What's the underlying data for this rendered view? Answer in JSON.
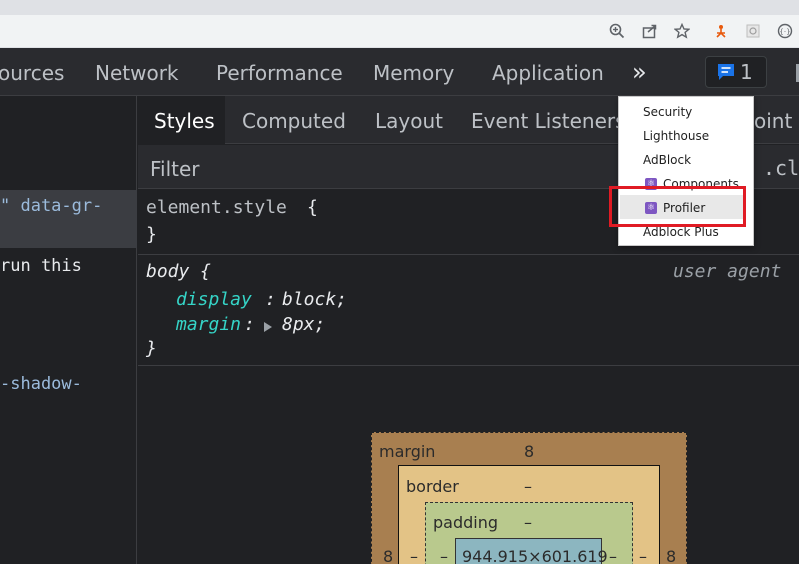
{
  "browser": {
    "icons": [
      "zoom-icon",
      "share-icon",
      "star-icon",
      "extension-ext1-icon",
      "extension-ext2-icon",
      "extension-ext3-icon"
    ]
  },
  "devtools": {
    "panel_tabs": [
      "ources",
      "Network",
      "Performance",
      "Memory",
      "Application"
    ],
    "more_tabs_glyph": "»",
    "issues_count": "1",
    "sub_tabs": [
      "Styles",
      "Computed",
      "Layout",
      "Event Listeners",
      "oint"
    ],
    "filter_placeholder": "Filter",
    "filter_right": ".cl",
    "dom_lines": [
      "\" data-gr-",
      "run this",
      "-shadow-"
    ],
    "rules": {
      "element_style": {
        "selector": "element.style",
        "open": "{",
        "close": "}"
      },
      "body": {
        "selector": "body",
        "open": "{",
        "origin": "user agent",
        "props": [
          {
            "name": "display",
            "value": "block;"
          },
          {
            "name": "margin",
            "value": "8px;"
          }
        ],
        "close": "}"
      }
    },
    "box_model": {
      "margin_label": "margin",
      "margin_top": "8",
      "margin_left": "8",
      "margin_right": "8",
      "border_label": "border",
      "border_top": "–",
      "border_left": "–",
      "border_right": "–",
      "padding_label": "padding",
      "padding_top": "–",
      "padding_left": "–",
      "padding_right": "–",
      "content": "944.915×601.619"
    }
  },
  "more_tabs_menu": {
    "items": [
      "Security",
      "Lighthouse",
      "AdBlock",
      "Components",
      "Profiler",
      "Adblock Plus"
    ],
    "highlighted": "Profiler"
  },
  "colors": {
    "highlight_box": "#e01b24",
    "accent": "#1a73e8",
    "react_icon": "#7e57c2"
  }
}
